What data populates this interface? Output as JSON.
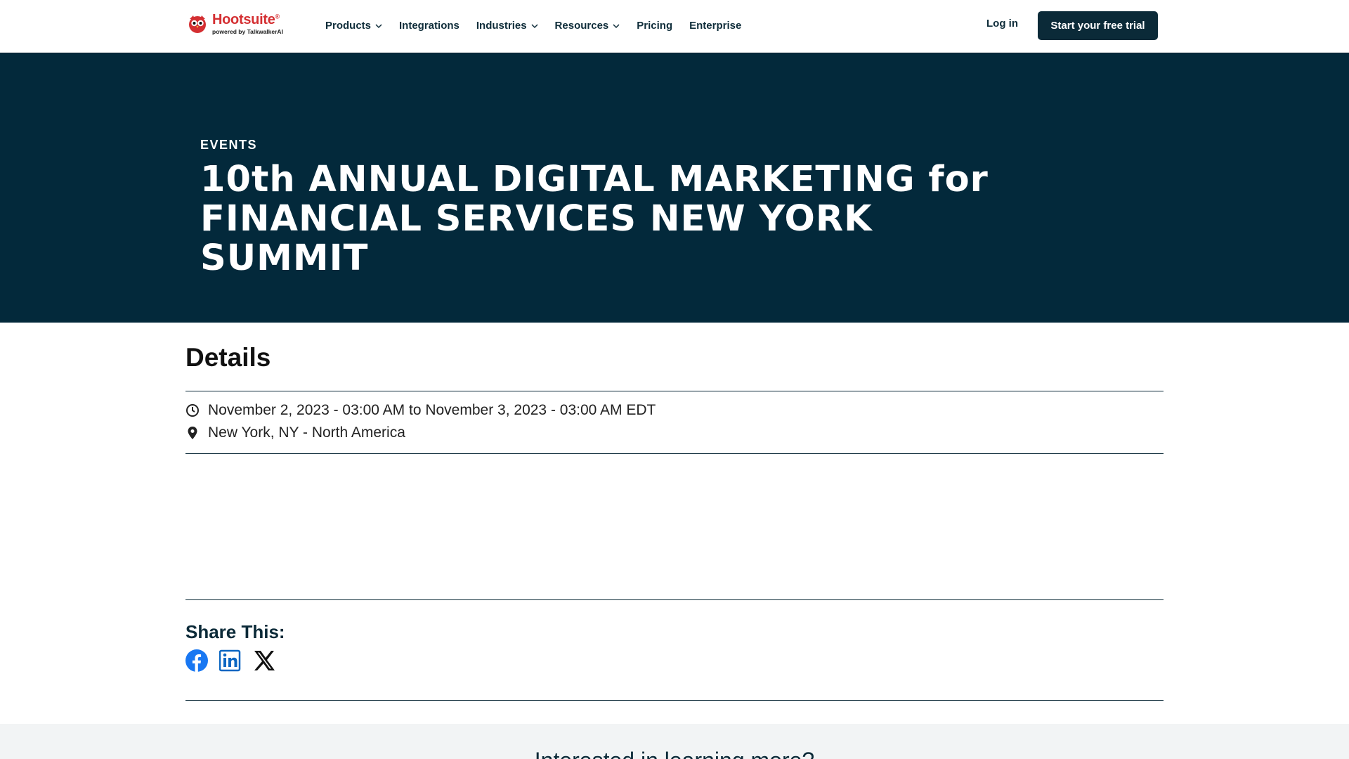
{
  "nav": {
    "logo_name": "Hootsuite",
    "logo_reg": "®",
    "logo_sub": "powered by TalkwalkerAI",
    "items": [
      {
        "label": "Products",
        "dropdown": true
      },
      {
        "label": "Integrations",
        "dropdown": false
      },
      {
        "label": "Industries",
        "dropdown": true
      },
      {
        "label": "Resources",
        "dropdown": true
      },
      {
        "label": "Pricing",
        "dropdown": false
      },
      {
        "label": "Enterprise",
        "dropdown": false
      }
    ],
    "login": "Log in",
    "cta": "Start your free trial"
  },
  "hero": {
    "eyebrow": "EVENTS",
    "title_line1": "10th ANNUAL DIGITAL MARKETING for",
    "title_line2": "FINANCIAL SERVICES NEW YORK SUMMIT"
  },
  "details": {
    "heading": "Details",
    "date": "November 2, 2023 - 03:00 AM to November 3, 2023 - 03:00 AM EDT",
    "location": "New York, NY - North America"
  },
  "share": {
    "heading": "Share This:",
    "icons": [
      "facebook-icon",
      "linkedin-icon",
      "x-icon"
    ]
  },
  "bottom": {
    "heading": "Interested in learning more?"
  },
  "colors": {
    "brand_red": "#d42f32",
    "navy": "#03293b",
    "button_navy": "#0b2a38",
    "facebook_blue": "#1877f2",
    "linkedin_blue": "#0a66c2"
  }
}
